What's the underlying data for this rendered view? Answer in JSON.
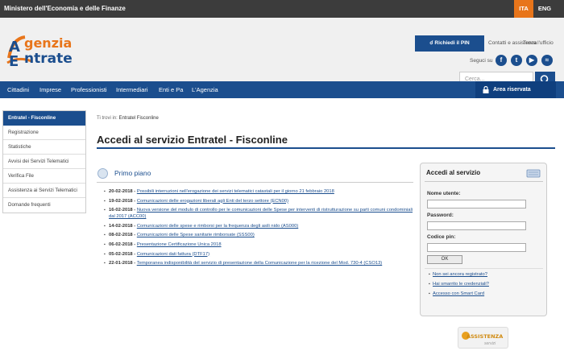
{
  "topbar": {
    "ministry": "Ministero dell'Economia e delle Finanze",
    "lang_ita": "ITA",
    "lang_eng": "ENG"
  },
  "header": {
    "logo_line1": "genzia",
    "logo_line2": "ntrate",
    "pin_button": "Richiedi il PIN",
    "contatti": "Contatti e assistenza",
    "trova_ufficio": "Trova l'ufficio",
    "follow": "Seguci su",
    "search_placeholder": "Cerca...",
    "social": [
      "facebook-icon",
      "twitter-icon",
      "youtube-icon",
      "rss-icon"
    ]
  },
  "nav": {
    "items": [
      "Cittadini",
      "Imprese",
      "Professionisti",
      "Intermediari",
      "Enti e Pa",
      "L'Agenzia"
    ],
    "area_riservata": "Area riservata"
  },
  "sidebar": {
    "items": [
      "Entratel - Fisconline",
      "Registrazione",
      "Statistiche",
      "Avvisi dei Servizi Telematici",
      "Verifica File",
      "Assistenza ai Servizi Telematici",
      "Domande frequenti"
    ]
  },
  "main": {
    "breadcrumb_prefix": "Ti trovi in:",
    "breadcrumb_current": "Entratel Fisconline",
    "title": "Accedi al servizio Entratel - Fisconline",
    "primo_piano": "Primo piano",
    "news": [
      {
        "date": "20-02-2018 -",
        "text": "Possibili interruzioni nell'erogazione dei servizi telematici catastali per il giorno 21 febbraio 2018"
      },
      {
        "date": "19-02-2018 -",
        "text": "Comunicazioni delle erogazioni liberali agli Enti del terzo settore (ECN00)"
      },
      {
        "date": "16-02-2018 -",
        "text": "Nuova versione del modulo di controllo per le comunicazioni delle Spese per interventi di ristrutturazione su parti comuni condominiali dal 2017 (ACC00)"
      },
      {
        "date": "14-02-2018 -",
        "text": "Comunicazioni delle spese e rimborsi per la frequenza degli asili nido (AS000)"
      },
      {
        "date": "08-02-2018 -",
        "text": "Comunicazioni delle Spese sanitarie rimborsate (SSS00)"
      },
      {
        "date": "06-02-2018 -",
        "text": "Presentazione Certificazione Unica 2018"
      },
      {
        "date": "05-02-2018 -",
        "text": "Comunicazioni dati fattura (DTF17)"
      },
      {
        "date": "22-01-2018 -",
        "text": "Temporanea indisponibilità del servizio di presentazione della Comunicazione per la ricezione del Mod. 730-4 (CSO13)"
      }
    ]
  },
  "login": {
    "title": "Accedi al servizio",
    "username_label": "Nome utente:",
    "password_label": "Password:",
    "pin_label": "Codice pin:",
    "ok_button": "OK",
    "links": [
      "Non sei ancora registrato?",
      "Hai smarrito le credenziali?",
      "Accesso con Smart Card"
    ]
  },
  "assistenza": {
    "title": "ASSISTENZA",
    "subtitle": "servizi"
  },
  "colors": {
    "brand_blue": "#1b4e8e",
    "orange": "#e8751a",
    "topbar": "#3c3c3c"
  }
}
